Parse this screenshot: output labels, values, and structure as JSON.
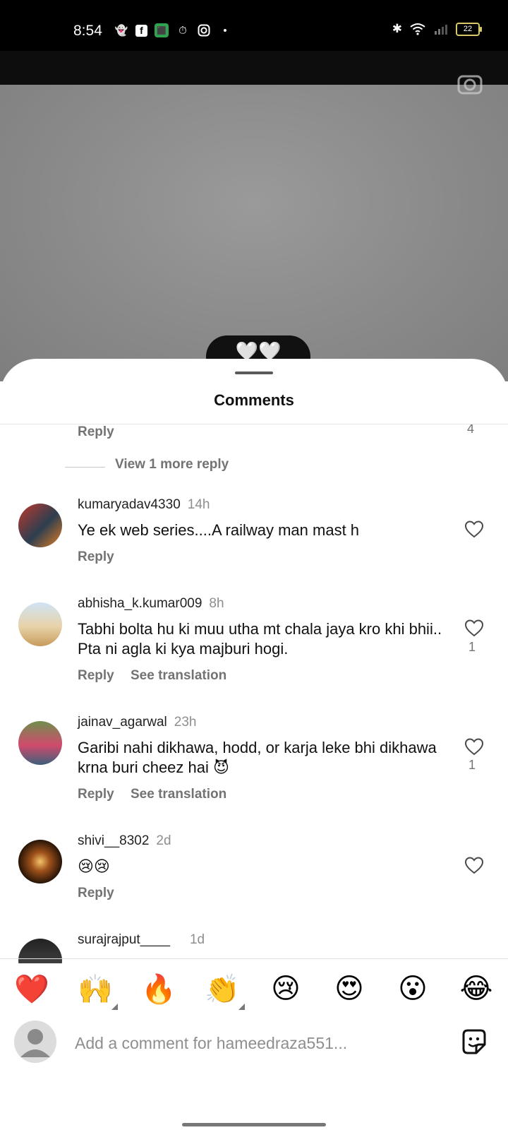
{
  "status_bar": {
    "time": "8:54",
    "battery": "22",
    "app_icons": [
      "snapchat-icon",
      "facebook-icon",
      "app-icon",
      "timer-icon",
      "instagram-icon"
    ]
  },
  "sheet": {
    "title": "Comments"
  },
  "top_partial": {
    "reply": "Reply",
    "likes": "4",
    "view_more": "View 1 more reply"
  },
  "comments": [
    {
      "username": "kumaryadav4330",
      "time": "14h",
      "text": "Ye ek web series....A railway man mast h",
      "likes": "",
      "reply": "Reply",
      "translation": ""
    },
    {
      "username": "abhisha_k.kumar009",
      "time": "8h",
      "text": "Tabhi bolta hu ki muu utha mt chala jaya kro khi bhii.. Pta ni agla ki kya majburi hogi.",
      "likes": "1",
      "reply": "Reply",
      "translation": "See translation"
    },
    {
      "username": "jainav_agarwal",
      "time": "23h",
      "text": "Garibi nahi dikhawa, hodd, or karja leke bhi dikhawa krna buri cheez hai 😈",
      "likes": "1",
      "reply": "Reply",
      "translation": "See translation"
    },
    {
      "username": "shivi__8302",
      "time": "2d",
      "text": "😢😢",
      "likes": "",
      "reply": "Reply",
      "translation": ""
    },
    {
      "username": "surajrajput____",
      "time": "1d",
      "text": "",
      "likes": "",
      "reply": "",
      "translation": ""
    }
  ],
  "reactions": [
    "❤️",
    "🙌",
    "🔥",
    "👏",
    "😢",
    "😍",
    "😮",
    "😂"
  ],
  "comment_input": {
    "placeholder": "Add a comment for hameedraza551..."
  },
  "colors": {
    "link_gray": "#737373",
    "text": "#111111",
    "status_bar": "#000000"
  }
}
